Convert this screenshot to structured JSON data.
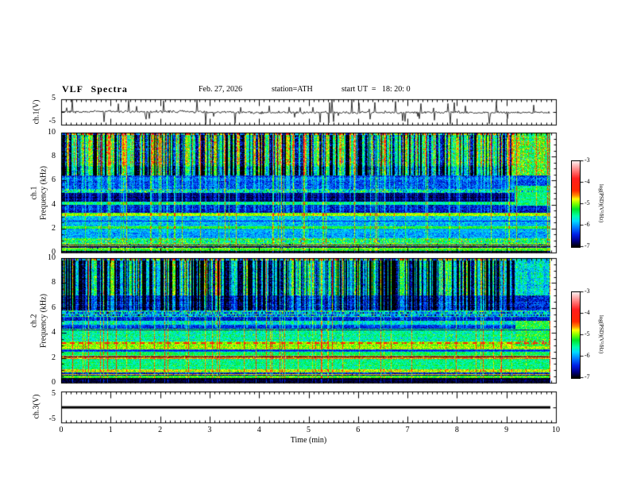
{
  "header": {
    "title": "VLF Spectra",
    "date": "Feb. 27, 2026",
    "station": "station=ATH",
    "start_ut": "start UT  =   18: 20: 0"
  },
  "axes": {
    "x_label": "Time (min)",
    "x_ticks": [
      "0",
      "1",
      "2",
      "3",
      "4",
      "5",
      "6",
      "7",
      "8",
      "9",
      "10"
    ],
    "freq_ticks": [
      "10",
      "8",
      "6",
      "4",
      "2",
      "0"
    ],
    "wave_volt_ticks": [
      "5",
      "-5"
    ],
    "ch3_volt_ticks": [
      "5",
      "-5"
    ],
    "ch1_wave_label": "ch.1(V)",
    "ch1_spec_channel": "ch.1",
    "ch2_spec_channel": "ch.2",
    "freq_axis_label": "Frequency (kHz)",
    "ch3_wave_label": "ch.3(V)"
  },
  "colorbar": {
    "label": "log(PSD)(V²/Hz)",
    "ticks": [
      "-3",
      "-4",
      "-5",
      "-6",
      "-7"
    ],
    "colormap_stops": [
      [
        0.0,
        [
          0,
          0,
          0
        ]
      ],
      [
        0.07,
        [
          0,
          0,
          140
        ]
      ],
      [
        0.14,
        [
          0,
          30,
          230
        ]
      ],
      [
        0.22,
        [
          0,
          120,
          255
        ]
      ],
      [
        0.3,
        [
          0,
          220,
          255
        ]
      ],
      [
        0.36,
        [
          0,
          255,
          170
        ]
      ],
      [
        0.44,
        [
          0,
          230,
          40
        ]
      ],
      [
        0.5,
        [
          120,
          255,
          0
        ]
      ],
      [
        0.56,
        [
          255,
          255,
          0
        ]
      ],
      [
        0.6,
        [
          255,
          140,
          0
        ]
      ],
      [
        0.66,
        [
          255,
          40,
          0
        ]
      ],
      [
        0.8,
        [
          255,
          30,
          30
        ]
      ],
      [
        0.92,
        [
          255,
          150,
          150
        ]
      ],
      [
        1.0,
        [
          255,
          235,
          235
        ]
      ]
    ]
  },
  "chart_data": [
    {
      "type": "line",
      "name": "ch1_waveform",
      "ylabel": "ch.1(V)",
      "ylim": [
        -5,
        5
      ],
      "xlim": [
        0,
        10
      ],
      "description": "noisy broadband trace centered near 0 V with impulsive spikes reaching about +5 and -5 V across the full 10 minutes",
      "seed": 7,
      "noise_sd": 0.5,
      "spike_count": 52,
      "spike_amp_max": 4.8
    },
    {
      "type": "heatmap",
      "name": "ch1_spectrogram",
      "ylabel": "ch.1 Frequency (kHz)",
      "xlim": [
        0,
        10
      ],
      "ylim": [
        0,
        10
      ],
      "clim_log_psd": [
        -7,
        -3
      ],
      "seed": 101,
      "bands": [
        [
          0.0,
          0.12,
          -6.85,
          0.15
        ],
        [
          0.12,
          0.28,
          -5.2,
          0.35
        ],
        [
          0.28,
          0.45,
          -6.7,
          0.4
        ],
        [
          0.45,
          0.58,
          -4.95,
          0.4
        ],
        [
          0.58,
          0.72,
          -6.6,
          0.35
        ],
        [
          0.72,
          1.15,
          -5.35,
          0.65
        ],
        [
          1.15,
          1.95,
          -5.95,
          0.4
        ],
        [
          1.95,
          2.18,
          -5.15,
          0.3
        ],
        [
          2.18,
          3.05,
          -5.9,
          0.45
        ],
        [
          3.05,
          3.28,
          -5.0,
          0.3
        ],
        [
          3.28,
          4.0,
          -6.55,
          0.4
        ],
        [
          4.0,
          4.22,
          -5.6,
          0.3
        ],
        [
          4.22,
          5.0,
          -6.8,
          0.3
        ],
        [
          5.0,
          5.3,
          -5.9,
          0.8
        ],
        [
          5.3,
          6.45,
          -6.3,
          0.45
        ],
        [
          6.45,
          7.2,
          -6.0,
          0.55
        ],
        [
          7.2,
          9.85,
          -5.55,
          0.55
        ],
        [
          9.85,
          10.01,
          -4.8,
          0.3
        ]
      ],
      "hlines": [
        [
          0.35,
          -4.9,
          1,
          "solid"
        ],
        [
          0.5,
          -6.9,
          1,
          "solid"
        ],
        [
          0.65,
          -4.9,
          1,
          "solid"
        ],
        [
          0.9,
          -5.4,
          2,
          "mix"
        ],
        [
          2.6,
          -6.4,
          1,
          "solid"
        ],
        [
          5.05,
          -5.6,
          2,
          "mix"
        ]
      ],
      "streaks": {
        "fmin": 6.45,
        "dark_p": 0.4,
        "bright_p": 0.28,
        "bright_ext": 3.3,
        "dark_ext": null,
        "renew": 0.7
      },
      "impulse_p": 0.1,
      "tail": {
        "t0": 9.28,
        "bands": [
          [
            3.9,
            5.6,
            -5.45,
            0.4
          ],
          [
            6.45,
            10.01,
            -5.1,
            0.55
          ]
        ],
        "speckle": [
          [
            6.45,
            10.01,
            0.04,
            -4.35
          ]
        ]
      }
    },
    {
      "type": "heatmap",
      "name": "ch2_spectrogram",
      "ylabel": "ch.2 Frequency (kHz)",
      "xlim": [
        0,
        10
      ],
      "ylim": [
        0,
        10
      ],
      "clim_log_psd": [
        -7,
        -3
      ],
      "seed": 202,
      "bands": [
        [
          0.0,
          0.38,
          -6.9,
          0.2
        ],
        [
          0.38,
          0.52,
          -5.1,
          0.3
        ],
        [
          0.52,
          0.78,
          -6.5,
          0.45
        ],
        [
          0.78,
          1.05,
          -4.9,
          0.45
        ],
        [
          1.05,
          1.9,
          -5.5,
          0.4
        ],
        [
          1.9,
          2.15,
          -4.6,
          0.3
        ],
        [
          2.15,
          2.5,
          -5.35,
          0.35
        ],
        [
          2.5,
          2.68,
          -6.2,
          0.3
        ],
        [
          2.68,
          3.3,
          -5.0,
          0.35
        ],
        [
          3.3,
          4.12,
          -5.55,
          0.45
        ],
        [
          4.12,
          4.3,
          -5.3,
          0.35
        ],
        [
          4.3,
          4.62,
          -6.4,
          0.35
        ],
        [
          4.62,
          4.95,
          -5.8,
          0.45
        ],
        [
          4.95,
          5.28,
          -6.45,
          0.35
        ],
        [
          5.28,
          5.78,
          -5.7,
          0.85
        ],
        [
          5.78,
          7.05,
          -6.35,
          0.45
        ],
        [
          7.05,
          9.85,
          -5.8,
          0.5
        ],
        [
          9.85,
          10.01,
          -4.85,
          0.3
        ]
      ],
      "hlines": [
        [
          0.3,
          -6.9,
          1,
          "solid"
        ],
        [
          0.62,
          -4.7,
          1,
          "solid"
        ],
        [
          2.02,
          -6.9,
          1,
          "solid"
        ],
        [
          2.55,
          -6.5,
          1,
          "solid"
        ],
        [
          3.15,
          -4.1,
          2,
          "dash"
        ],
        [
          4.2,
          -6.5,
          1,
          "solid"
        ],
        [
          5.38,
          -6.1,
          2,
          "mix"
        ],
        [
          5.6,
          -6.1,
          2,
          "mix"
        ]
      ],
      "streaks": {
        "fmin": 7.05,
        "dark_p": 0.48,
        "bright_p": 0.18,
        "bright_ext": 4.4,
        "dark_ext": 5.8,
        "renew": 0.7
      },
      "impulse_p": 0.08,
      "tail": {
        "t0": 9.3,
        "bands": [
          [
            2.9,
            5.0,
            -5.3,
            0.45
          ],
          [
            7.05,
            10.01,
            -5.55,
            0.5
          ]
        ],
        "speckle": [
          [
            3.0,
            3.35,
            0.2,
            -4.25
          ]
        ]
      }
    },
    {
      "type": "line",
      "name": "ch3_waveform",
      "ylabel": "ch.3(V)",
      "ylim": [
        -5,
        5
      ],
      "xlim": [
        0,
        10
      ],
      "flat_value": 0,
      "description": "completely flat thick black line at 0 V (no signal on channel 3)"
    }
  ]
}
